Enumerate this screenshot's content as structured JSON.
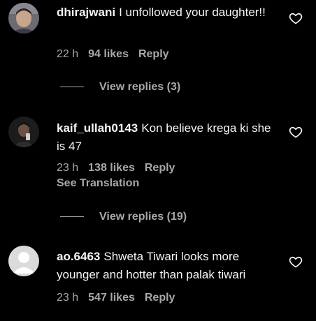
{
  "comments": [
    {
      "username": "dhirajwani",
      "text": "I unfollowed your daughter!!",
      "time": "22 h",
      "likes": "94 likes",
      "reply_label": "Reply",
      "view_replies": "View replies (3)"
    },
    {
      "username": "kaif_ullah0143",
      "text": "Kon believe krega ki she is 47",
      "time": "23 h",
      "likes": "138 likes",
      "reply_label": "Reply",
      "translation_label": "See Translation",
      "view_replies": "View replies (19)"
    },
    {
      "username": "ao.6463",
      "text": "Shweta Tiwari looks more younger and hotter than palak tiwari",
      "time": "23 h",
      "likes": "547 likes",
      "reply_label": "Reply"
    }
  ],
  "icons": {
    "like": "heart-outline-icon",
    "avatar_default": "default-avatar-icon"
  },
  "colors": {
    "background": "#000000",
    "text": "#f5f5f5",
    "secondary": "#a8a8a8"
  }
}
